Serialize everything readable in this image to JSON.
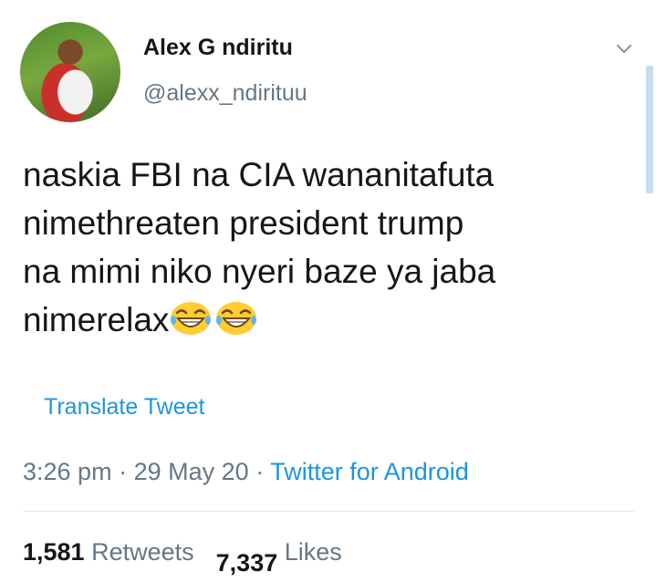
{
  "author": {
    "name": "Alex G ndiritu",
    "handle": "@alexx_ndirituu"
  },
  "tweet": {
    "lines": [
      "naskia FBI na CIA wananitafuta",
      "nimethreaten president trump",
      "na mimi niko nyeri baze ya jaba",
      "nimerelax"
    ],
    "emojis": [
      "laughing-emoji",
      "laughing-emoji"
    ]
  },
  "translate_label": "Translate Tweet",
  "meta": {
    "time": "3:26 pm",
    "separator": "·",
    "date": "29 May 20",
    "source": "Twitter for Android"
  },
  "stats": {
    "retweets_count": "1,581",
    "retweets_label": "Retweets",
    "likes_count": "7,337",
    "likes_label": "Likes"
  },
  "colors": {
    "link": "#1b95e0",
    "secondary_text": "#657786",
    "primary_text": "#14171a"
  }
}
